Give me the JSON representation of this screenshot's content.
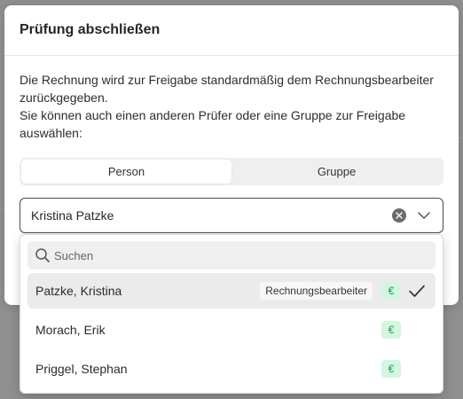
{
  "modal": {
    "title": "Prüfung abschließen",
    "description_line1": "Die Rechnung wird zur Freigabe standardmäßig dem Rechnungsbearbeiter zurückgegeben.",
    "description_line2": "Sie können auch einen anderen Prüfer oder eine Gruppe zur Freigabe auswählen:"
  },
  "toggle": {
    "options": [
      {
        "label": "Person",
        "active": true
      },
      {
        "label": "Gruppe",
        "active": false
      }
    ]
  },
  "select": {
    "value": "Kristina Patzke",
    "clear_icon": "close-icon",
    "chevron_icon": "chevron-down-icon"
  },
  "dropdown": {
    "search_placeholder": "Suchen",
    "options": [
      {
        "name": "Patzke, Kristina",
        "badge": "Rechnungsbearbeiter",
        "currency": "€",
        "selected": true
      },
      {
        "name": "Morach, Erik",
        "badge": "",
        "currency": "€",
        "selected": false
      },
      {
        "name": "Priggel, Stephan",
        "badge": "",
        "currency": "€",
        "selected": false
      }
    ]
  },
  "colors": {
    "overlay": "#8f8f8f",
    "euro_bg": "#d4f5e0",
    "euro_fg": "#1f9a55",
    "selected_row": "#ebebeb"
  }
}
